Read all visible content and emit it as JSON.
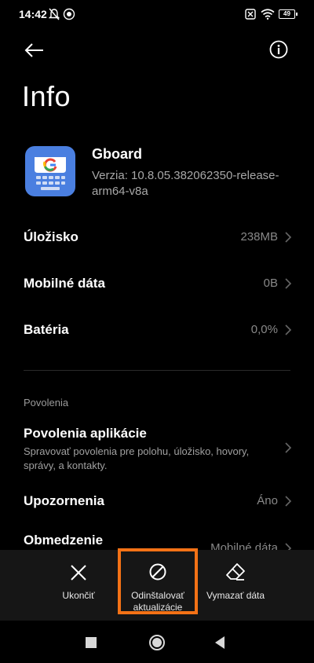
{
  "status": {
    "time": "14:42",
    "battery": "49"
  },
  "header": {
    "title": "Info"
  },
  "app": {
    "name": "Gboard",
    "version": "Verzia: 10.8.05.382062350-release-arm64-v8a"
  },
  "rows": [
    {
      "label": "Úložisko",
      "value": "238MB"
    },
    {
      "label": "Mobilné dáta",
      "value": "0B"
    },
    {
      "label": "Batéria",
      "value": "0,0%"
    }
  ],
  "permissions": {
    "header": "Povolenia",
    "app_permissions": {
      "label": "Povolenia aplikácie",
      "desc": "Spravovať povolenia pre polohu, úložisko, hovory, správy, a kontakty."
    },
    "notifications": {
      "label": "Upozornenia",
      "value": "Áno"
    },
    "restriction": {
      "label": "Obmedzenie",
      "value": "Mobilné dáta"
    }
  },
  "actions": {
    "close": "Ukončiť",
    "uninstall_updates": "Odinštalovať aktualizácie",
    "clear_data": "Vymazať dáta"
  },
  "colors": {
    "background": "#000000",
    "highlight": "#f47216",
    "bar": "#161616",
    "app_icon": "#4a7fe0"
  }
}
